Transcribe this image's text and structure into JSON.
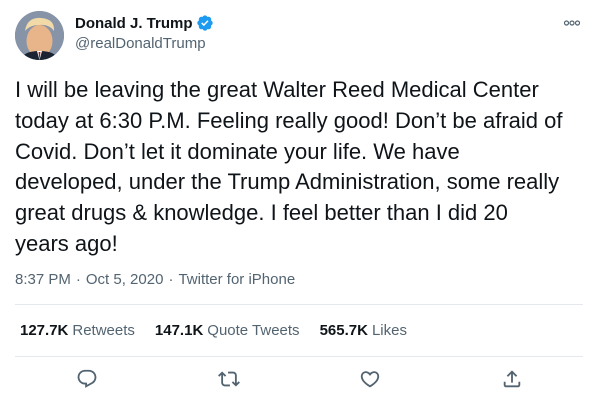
{
  "author": {
    "display_name": "Donald J. Trump",
    "handle": "@realDonaldTrump",
    "verified": true,
    "avatar_icon": "profile-photo"
  },
  "tweet": {
    "text": "I will be leaving the great Walter Reed Medical Center\ntoday at 6:30 P.M. Feeling really good! Don’t be afraid of\nCovid. Don’t let it dominate your life. We have\ndeveloped, under the Trump Administration, some really\ngreat drugs & knowledge. I feel better than I did 20\nyears ago!",
    "time": "8:37 PM",
    "separator": "·",
    "date": "Oct 5, 2020",
    "source": "Twitter for iPhone"
  },
  "stats": {
    "retweets_count": "127.7K",
    "retweets_label": "Retweets",
    "quotes_count": "147.1K",
    "quotes_label": "Quote Tweets",
    "likes_count": "565.7K",
    "likes_label": "Likes"
  },
  "icons": {
    "more": "more-dots-icon",
    "reply": "reply-icon",
    "retweet": "retweet-icon",
    "like": "heart-icon",
    "share": "share-icon",
    "verified": "verified-badge-icon"
  },
  "colors": {
    "text_primary": "#0f1419",
    "text_secondary": "#536471",
    "verified_blue": "#1d9bf0",
    "divider": "#e5e9ed"
  }
}
